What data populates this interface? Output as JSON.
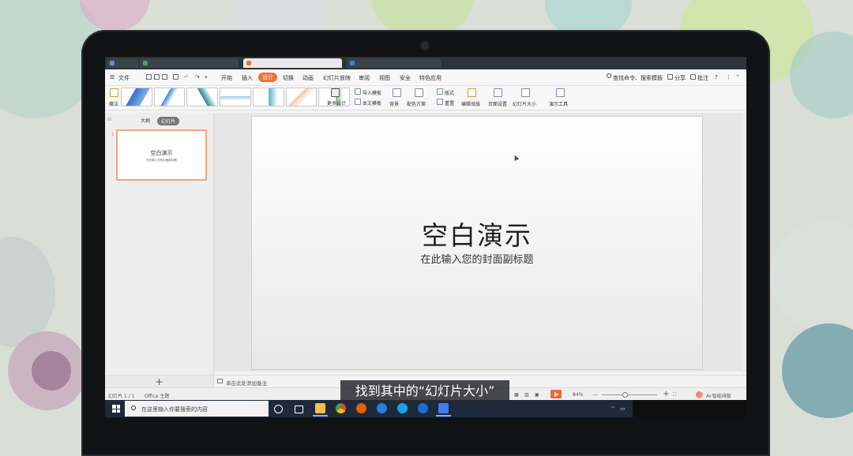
{
  "menu": {
    "file": "文件",
    "items": [
      "开始",
      "插入",
      "设计",
      "切换",
      "动画",
      "幻灯片放映",
      "审阅",
      "视图",
      "安全",
      "特色应用"
    ],
    "active": "设计",
    "search": "查找命令、搜索模板",
    "share": "分享",
    "comment": "批注"
  },
  "ribbon": {
    "magic": "魔法",
    "more_design": "更多设计",
    "import_template": "导入模板",
    "text_template": "本文模板",
    "background": "背景",
    "color_scheme": "配色方案",
    "layout": "版式",
    "reset": "重置",
    "edit_master": "编辑母版",
    "page_setup": "页面设置",
    "slide_size": "幻灯片大小",
    "show_tools": "演示工具"
  },
  "panel": {
    "tab_outline": "大纲",
    "tab_slides": "幻灯片",
    "slide_number": "1",
    "thumb_title": "空白演示",
    "thumb_subtitle": "在此输入您的封面副标题",
    "add": "+"
  },
  "slide": {
    "title": "空白演示",
    "subtitle": "在此输入您的封面副标题"
  },
  "notes": {
    "placeholder": "单击此处添加备注"
  },
  "status": {
    "slide_count": "幻灯片 1 / 1",
    "theme": "Office 主题",
    "zoom": "84%",
    "ai": "AI·智能排版"
  },
  "taskbar": {
    "search_placeholder": "在这里输入你要搜索的内容"
  },
  "caption": "找到其中的“幻灯片大小”",
  "colors": {
    "accent": "#f26f32",
    "taskbar": "#1e2a3a",
    "bezel": "#111214"
  }
}
